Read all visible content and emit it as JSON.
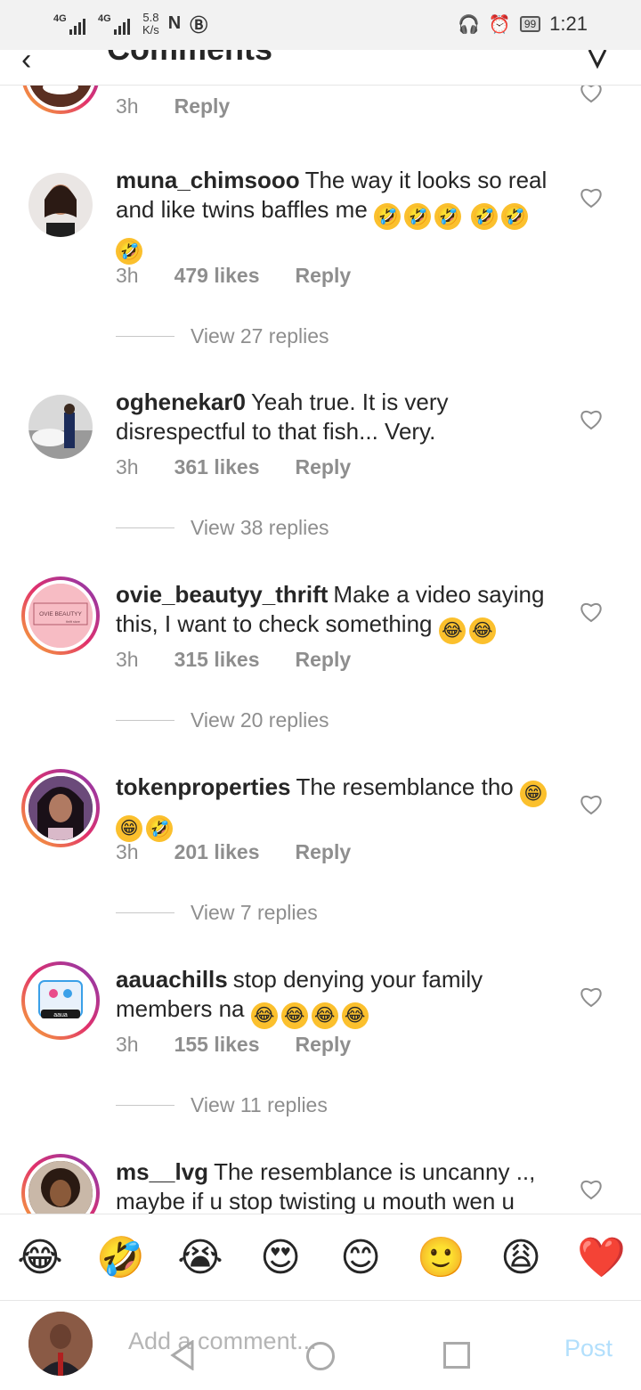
{
  "status_bar": {
    "net1": "4G",
    "net2": "4G",
    "speed_value": "5.8",
    "speed_unit": "K/s",
    "battery": "99",
    "time": "1:21"
  },
  "header": {
    "title": "Comments",
    "back_icon": "back-arrow-icon",
    "send_icon": "send-icon"
  },
  "comments": [
    {
      "user": "",
      "text": "",
      "time": "3h",
      "likes": "",
      "reply": "Reply",
      "view_replies": ""
    },
    {
      "user": "muna_chimsooo",
      "text": "The way it looks so real and like twins baffles me",
      "emojis": [
        "rofl",
        "rofl",
        "rofl",
        "rofl",
        "rofl",
        "rofl"
      ],
      "time": "3h",
      "likes": "479 likes",
      "reply": "Reply",
      "view_replies": "View 27 replies"
    },
    {
      "user": "oghenekar0",
      "text": "Yeah true. It is very disrespectful to that fish... Very.",
      "emojis": [],
      "time": "3h",
      "likes": "361 likes",
      "reply": "Reply",
      "view_replies": "View 38 replies"
    },
    {
      "user": "ovie_beautyy_thrift",
      "text": "Make a video saying this, I want to check something",
      "emojis": [
        "joy",
        "joy"
      ],
      "avatar_text": "OVIE BEAUTYY",
      "avatar_subtext": "thrift store",
      "time": "3h",
      "likes": "315 likes",
      "reply": "Reply",
      "view_replies": "View 20 replies"
    },
    {
      "user": "tokenproperties",
      "text": "The resemblance tho",
      "emojis": [
        "grin",
        "grin",
        "rofl"
      ],
      "time": "3h",
      "likes": "201 likes",
      "reply": "Reply",
      "view_replies": "View 7 replies"
    },
    {
      "user": "aauachills",
      "text": "stop denying your family members na",
      "emojis": [
        "joy",
        "joy",
        "joy",
        "joy"
      ],
      "avatar_text": "aaua",
      "time": "3h",
      "likes": "155 likes",
      "reply": "Reply",
      "view_replies": "View 11 replies"
    },
    {
      "user": "ms__lvg",
      "text": "The resemblance is uncanny .., maybe if u stop twisting u mouth wen u",
      "emojis": []
    }
  ],
  "emoji_bar": [
    "😂",
    "🤣",
    "😭",
    "😍",
    "😊",
    "🙂",
    "😩",
    "❤️"
  ],
  "input": {
    "placeholder": "Add a comment...",
    "post_label": "Post"
  },
  "colors": {
    "accent_post": "#b2dffc",
    "meta_grey": "#8e8e8e",
    "story_ring_start": "#f9b233",
    "story_ring_end": "#833ab4"
  }
}
